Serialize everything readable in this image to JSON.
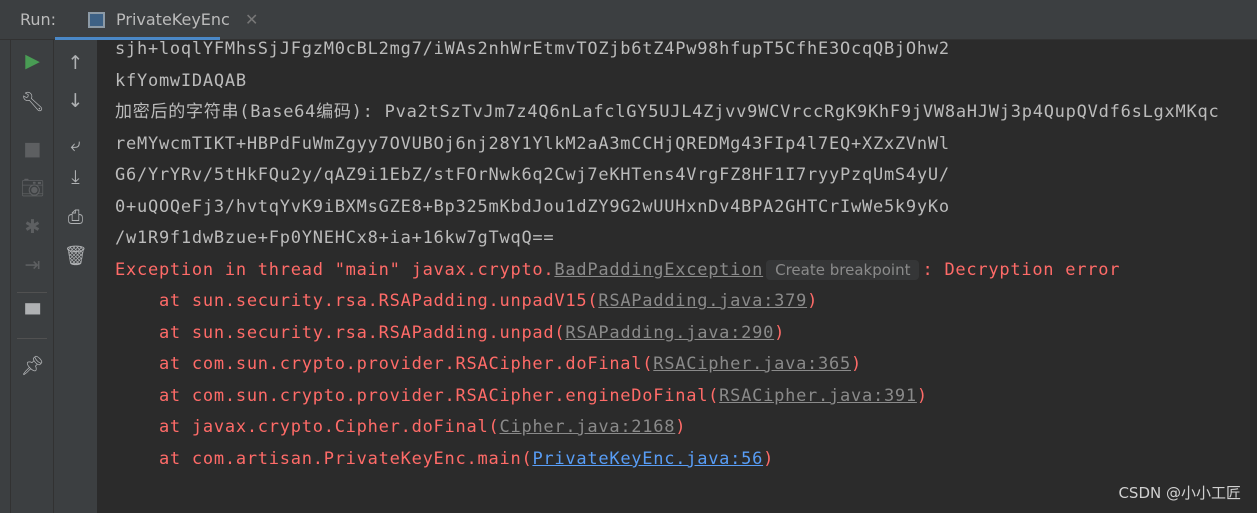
{
  "header": {
    "run_label": "Run:",
    "tab_label": "PrivateKeyEnc"
  },
  "toolbar": {
    "left": [
      "run-icon",
      "wrench-icon",
      "stop-icon",
      "camera-icon",
      "debug-icon",
      "exit-icon",
      "layout-icon",
      "pin-icon"
    ],
    "right": [
      "up-arrow-icon",
      "down-arrow-icon",
      "soft-wrap-icon",
      "scroll-to-end-icon",
      "print-icon",
      "trash-icon"
    ]
  },
  "console": {
    "output": [
      "sjh+loqlYFMhsSjJFgzM0cBL2mg7/iWAs2nhWrEtmvTOZjb6tZ4Pw98hfupT5CfhE3OcqQBjOhw2",
      "kfYomwIDAQAB"
    ],
    "encrypted_label": "加密后的字符串(Base64编码): ",
    "encrypted_lines": [
      "Pva2tSzTvJm7z4Q6nLafclGY5UJL4Zjvv9WCVrccRgK9KhF9jVW8aHJWj3p4QupQVdf6sLgxMKqc",
      "reMYwcmTIKT+HBPdFuWmZgyy7OVUBOj6nj28Y1YlkM2aA3mCCHjQREDMg43FIp4l7EQ+XZxZVnWl",
      "G6/YrYRv/5tHkFQu2y/qAZ9i1EbZ/stFOrNwk6q2Cwj7eKHTens4VrgFZ8HF1I7ryyPzqUmS4yU/",
      "0+uQOQeFj3/hvtqYvK9iBXMsGZE8+Bp325mKbdJou1dZY9G2wUUHxnDv4BPA2GHTCrIwWe5k9yKo",
      "/w1R9f1dwBzue+Fp0YNEHCx8+ia+16kw7gTwqQ=="
    ],
    "exception": {
      "prefix": "Exception in thread \"main\" javax.crypto.",
      "class": "BadPaddingException",
      "breakpoint": "Create breakpoint",
      "message": ": Decryption error"
    },
    "stack": [
      {
        "at": "    at sun.security.rsa.RSAPadding.unpadV15(",
        "link": "RSAPadding.java:379"
      },
      {
        "at": "    at sun.security.rsa.RSAPadding.unpad(",
        "link": "RSAPadding.java:290"
      },
      {
        "at": "    at com.sun.crypto.provider.RSACipher.doFinal(",
        "link": "RSACipher.java:365"
      },
      {
        "at": "    at com.sun.crypto.provider.RSACipher.engineDoFinal(",
        "link": "RSACipher.java:391"
      },
      {
        "at": "    at javax.crypto.Cipher.doFinal(",
        "link": "Cipher.java:2168"
      },
      {
        "at": "    at com.artisan.PrivateKeyEnc.main(",
        "link": "PrivateKeyEnc.java:56"
      }
    ],
    "close_paren": ")"
  },
  "watermark": "CSDN @小小工匠",
  "colors": {
    "error": "#ff6b68",
    "link": "#589df6",
    "background": "#2b2b2b"
  }
}
